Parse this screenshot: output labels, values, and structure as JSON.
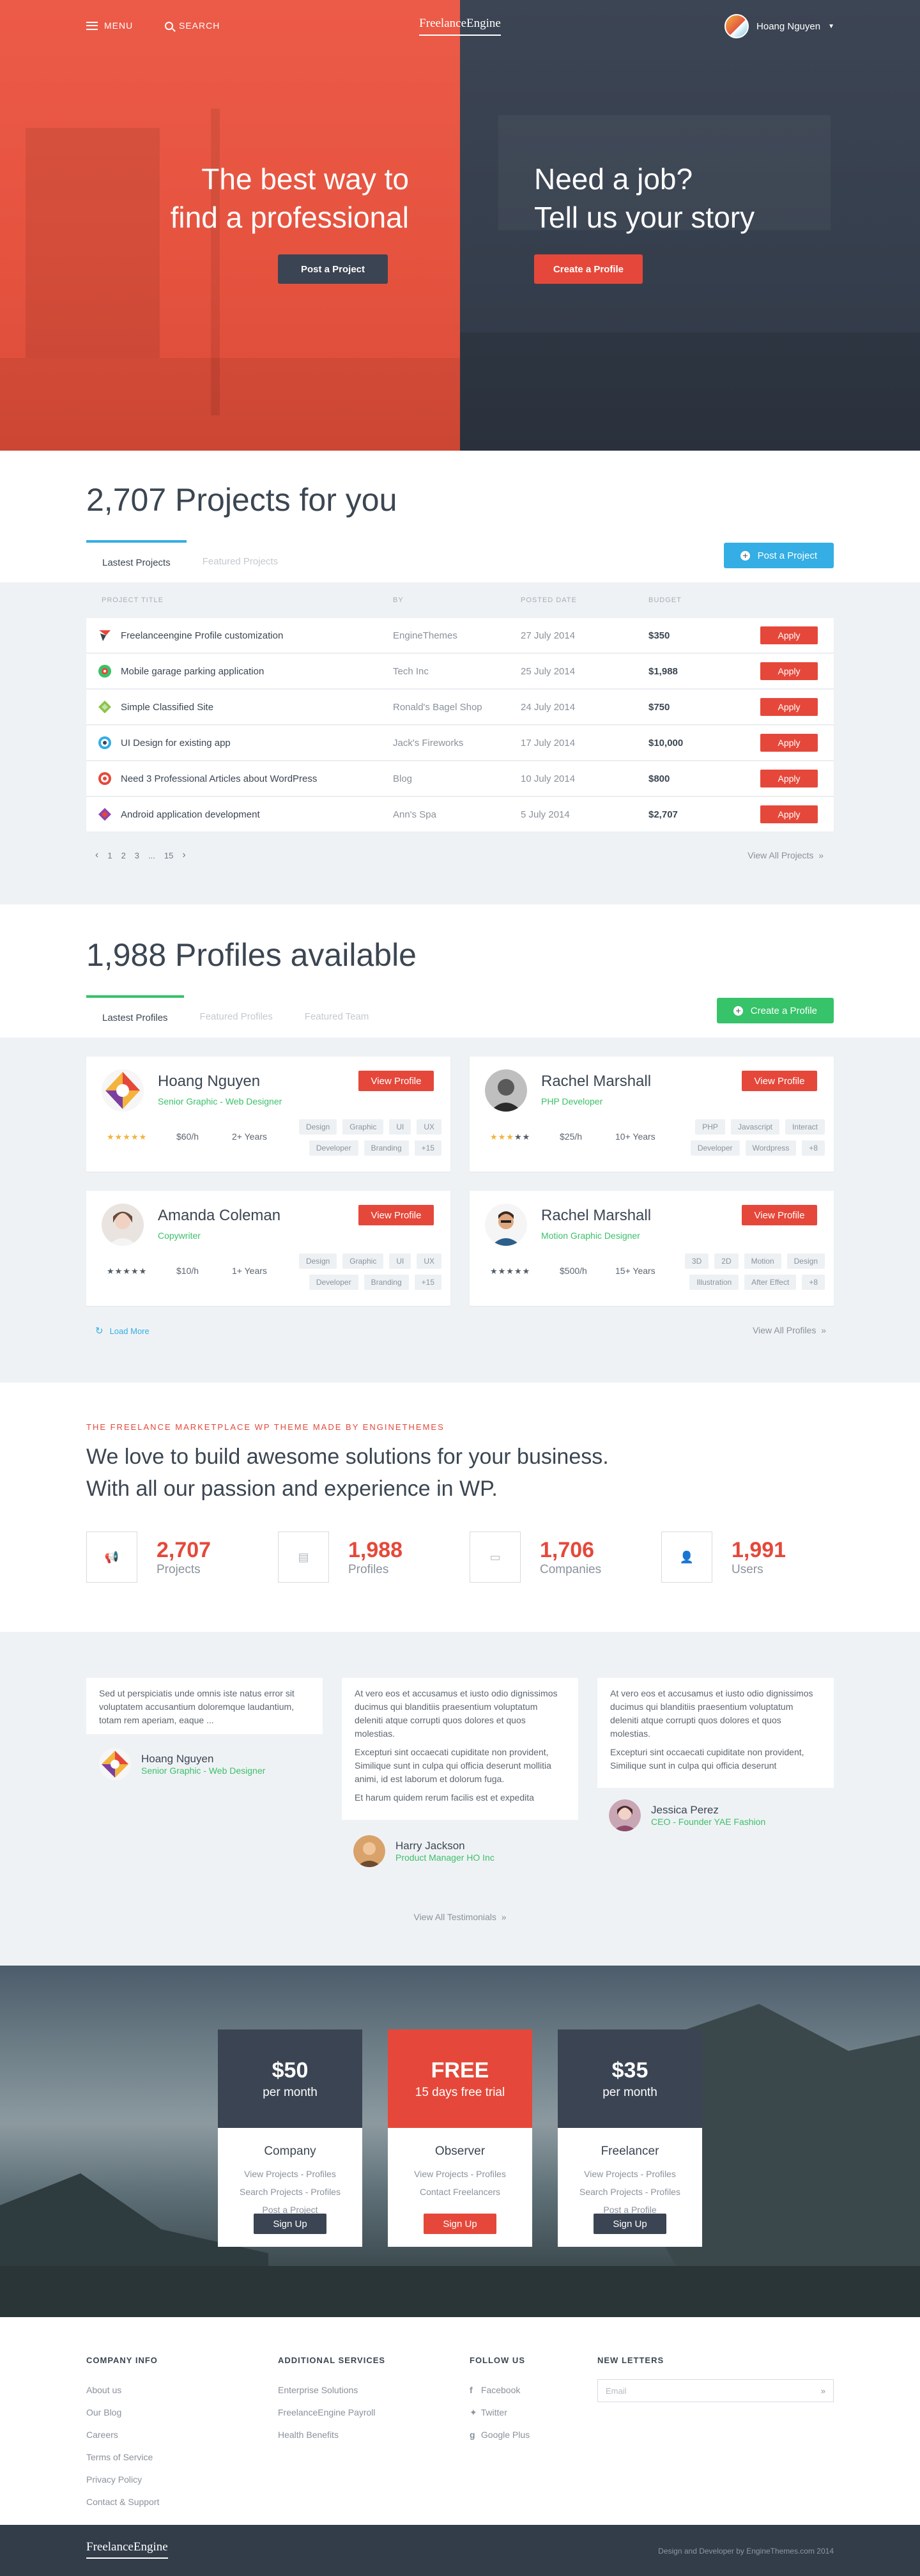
{
  "header": {
    "menu_label": "MENU",
    "search_label": "SEARCH",
    "logo": "FreelanceEngine",
    "user_name": "Hoang Nguyen"
  },
  "hero": {
    "left_line1": "The best way to",
    "left_line2": "find a professional",
    "left_button": "Post a Project",
    "right_line1": "Need a job?",
    "right_line2": "Tell us your story",
    "right_button": "Create a Profile"
  },
  "projects": {
    "title": "2,707 Projects for you",
    "tab_latest": "Lastest Projects",
    "tab_featured": "Featured Projects",
    "post_button": "Post a Project",
    "columns": [
      "PROJECT TITLE",
      "BY",
      "POSTED DATE",
      "BUDGET"
    ],
    "rows": [
      {
        "title": "Freelanceengine Profile customization",
        "by": "EngineThemes",
        "date": "27 July 2014",
        "budget": "$350",
        "action": "Apply"
      },
      {
        "title": "Mobile garage parking application",
        "by": "Tech Inc",
        "date": "25 July 2014",
        "budget": "$1,988",
        "action": "Apply"
      },
      {
        "title": "Simple Classified Site",
        "by": "Ronald's Bagel Shop",
        "date": "24 July 2014",
        "budget": "$750",
        "action": "Apply"
      },
      {
        "title": "UI Design for existing app",
        "by": "Jack's Fireworks",
        "date": "17 July 2014",
        "budget": "$10,000",
        "action": "Apply"
      },
      {
        "title": "Need 3 Professional Articles about WordPress",
        "by": "Blog",
        "date": "10 July 2014",
        "budget": "$800",
        "action": "Apply"
      },
      {
        "title": "Android application development",
        "by": "Ann's Spa",
        "date": "5 July 2014",
        "budget": "$2,707",
        "action": "Apply"
      }
    ],
    "pages": [
      "1",
      "2",
      "3",
      "...",
      "15"
    ],
    "view_all": "View All Projects"
  },
  "profiles": {
    "title": "1,988 Profiles available",
    "tab_latest": "Lastest Profiles",
    "tab_featured": "Featured Profiles",
    "tab_team": "Featured Team",
    "create_button": "Create a Profile",
    "view_button": "View Profile",
    "cards": [
      {
        "name": "Hoang Nguyen",
        "role": "Senior Graphic - Web Designer",
        "rate": "$60/h",
        "years": "2+ Years",
        "skills": [
          "Design",
          "Graphic",
          "UI",
          "UX",
          "Developer",
          "Branding",
          "+15"
        ]
      },
      {
        "name": "Rachel Marshall",
        "role": "PHP Developer",
        "rate": "$25/h",
        "years": "10+ Years",
        "skills": [
          "PHP",
          "Javascript",
          "Interact",
          "Developer",
          "Wordpress",
          "+8"
        ]
      },
      {
        "name": "Amanda Coleman",
        "role": "Copywriter",
        "rate": "$10/h",
        "years": "1+ Years",
        "skills": [
          "Design",
          "Graphic",
          "UI",
          "UX",
          "Developer",
          "Branding",
          "+15"
        ]
      },
      {
        "name": "Rachel Marshall",
        "role": "Motion Graphic Designer",
        "rate": "$500/h",
        "years": "15+ Years",
        "skills": [
          "3D",
          "2D",
          "Motion",
          "Design",
          "Illustration",
          "After Effect",
          "+8"
        ]
      }
    ],
    "load_more": "Load More",
    "view_all": "View All Profiles"
  },
  "stats": {
    "kicker": "THE FREELANCE MARKETPLACE WP THEME MADE BY ENGINETHEMES",
    "headline1": "We love to build awesome solutions for your business.",
    "headline2": "With all our passion and experience in WP.",
    "items": [
      {
        "value": "2,707",
        "label": "Projects"
      },
      {
        "value": "1,988",
        "label": "Profiles"
      },
      {
        "value": "1,706",
        "label": "Companies"
      },
      {
        "value": "1,991",
        "label": "Users"
      }
    ]
  },
  "testimonials": {
    "items": [
      {
        "text": "Sed ut perspiciatis unde omnis iste natus error sit voluptatem accusantium doloremque laudantium, totam rem aperiam, eaque ...",
        "name": "Hoang Nguyen",
        "role": "Senior Graphic - Web Designer"
      },
      {
        "text1": "At vero eos et accusamus et iusto odio dignissimos ducimus qui blanditiis praesentium voluptatum deleniti atque corrupti quos dolores et quos molestias.",
        "text2": "Excepturi sint occaecati cupiditate non provident, Similique sunt in culpa qui officia deserunt mollitia animi, id est laborum et dolorum fuga.",
        "text3": "Et harum quidem rerum facilis est et expedita",
        "name": "Harry Jackson",
        "role": "Product Manager HO Inc"
      },
      {
        "text1": "At vero eos et accusamus et iusto odio dignissimos ducimus qui blanditiis praesentium voluptatum deleniti atque corrupti quos dolores et quos molestias.",
        "text2": "Excepturi sint occaecati cupiditate non provident, Similique sunt in culpa qui officia deserunt",
        "name": "Jessica Perez",
        "role": "CEO - Founder YAE Fashion"
      }
    ],
    "view_all": "View All Testimonials"
  },
  "pricing": {
    "plans": [
      {
        "price": "$50",
        "period": "per month",
        "name": "Company",
        "features": [
          "View Projects - Profiles",
          "Search Projects - Profiles",
          "Post a Project"
        ],
        "button": "Sign Up"
      },
      {
        "price": "FREE",
        "period": "15 days free trial",
        "name": "Observer",
        "features": [
          "View Projects - Profiles",
          "Contact Freelancers"
        ],
        "button": "Sign Up"
      },
      {
        "price": "$35",
        "period": "per month",
        "name": "Freelancer",
        "features": [
          "View Projects - Profiles",
          "Search Projects - Profiles",
          "Post a Profile"
        ],
        "button": "Sign Up"
      }
    ]
  },
  "footer": {
    "company_title": "COMPANY INFO",
    "company_links": [
      "About us",
      "Our Blog",
      "Careers",
      "Terms of Service",
      "Privacy Policy",
      "Contact & Support"
    ],
    "services_title": "ADDITIONAL SERVICES",
    "services_links": [
      "Enterprise Solutions",
      "FreelanceEngine Payroll",
      "Health Benefits"
    ],
    "follow_title": "FOLLOW US",
    "follow_links": [
      "Facebook",
      "Twitter",
      "Google Plus"
    ],
    "news_title": "NEW LETTERS",
    "email_placeholder": "Email",
    "logo": "FreelanceEngine",
    "credit": "Design and Developer by EngineThemes.com 2014"
  },
  "colors": {
    "accent_red": "#e5483a",
    "dark_navy": "#3b4452",
    "green": "#36c36a",
    "blue": "#34aee4"
  }
}
